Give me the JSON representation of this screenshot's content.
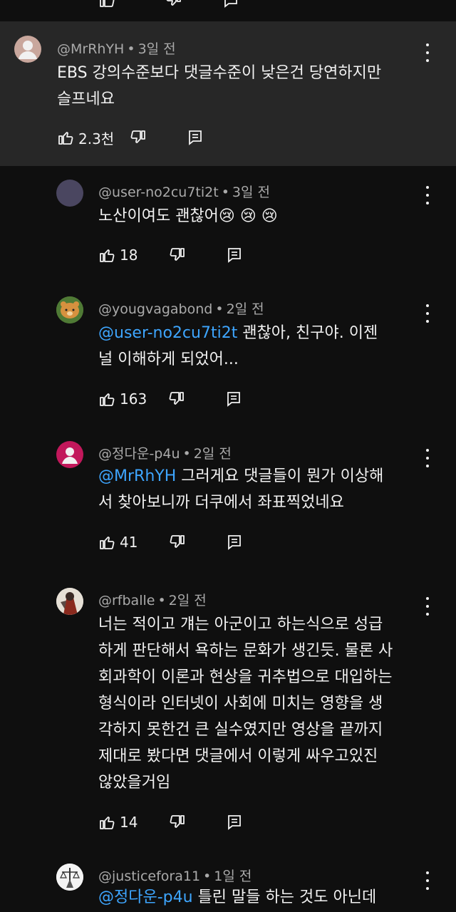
{
  "main_comment": {
    "handle": "@MrRhYH",
    "time": "3일 전",
    "text_line1": "EBS 강의수준보다 댓글수준이 낮은건 당연하지만",
    "text_line2": "슬프네요",
    "likes": "2.3천"
  },
  "replies": [
    {
      "handle": "@user-no2cu7ti2t",
      "time": "3일 전",
      "text_line1": "노산이여도 괜찮어😢 😢 😢",
      "likes": "18"
    },
    {
      "handle": "@yougvagabond",
      "time": "2일 전",
      "mention": "@user-no2cu7ti2t",
      "text_line1_rest": " 괜찮아, 친구야. 이젠",
      "text_line2": "널 이해하게 되었어...",
      "likes": "163"
    },
    {
      "handle": "@정다운-p4u",
      "time": "2일 전",
      "mention": "@MrRhYH",
      "text_line1_rest": " 그러게요 댓글들이 뭔가 이상해",
      "text_line2": "서 찾아보니까 더쿠에서 좌표찍었네요",
      "likes": "41"
    },
    {
      "handle": "@rfballe",
      "time": "2일 전",
      "lines": [
        "너는 적이고 걔는 아군이고 하는식으로 성급",
        "하게 판단해서 욕하는 문화가 생긴듯. 물론 사",
        "회과학이 이론과 현상을 귀추법으로 대입하는",
        "형식이라 인터넷이 사회에 미치는 영향을 생",
        "각하지 못한건 큰 실수였지만 영상을 끝까지",
        "제대로 봤다면 댓글에서 이렇게 싸우고있진",
        "않았을거임"
      ],
      "likes": "14"
    },
    {
      "handle": "@justicefora11",
      "time": "1일 전",
      "mention": "@정다운-p4u",
      "text_line1_rest": " 틀린 말들 하는 것도 아닌데"
    }
  ],
  "icons": {
    "like": "thumbs-up-icon",
    "dislike": "thumbs-down-icon",
    "reply": "reply-icon",
    "more": "more-vert-icon"
  },
  "colors": {
    "background": "#0f0f0f",
    "highlight": "#272727",
    "mention": "#3ea6ff",
    "meta": "#aaaaaa"
  }
}
